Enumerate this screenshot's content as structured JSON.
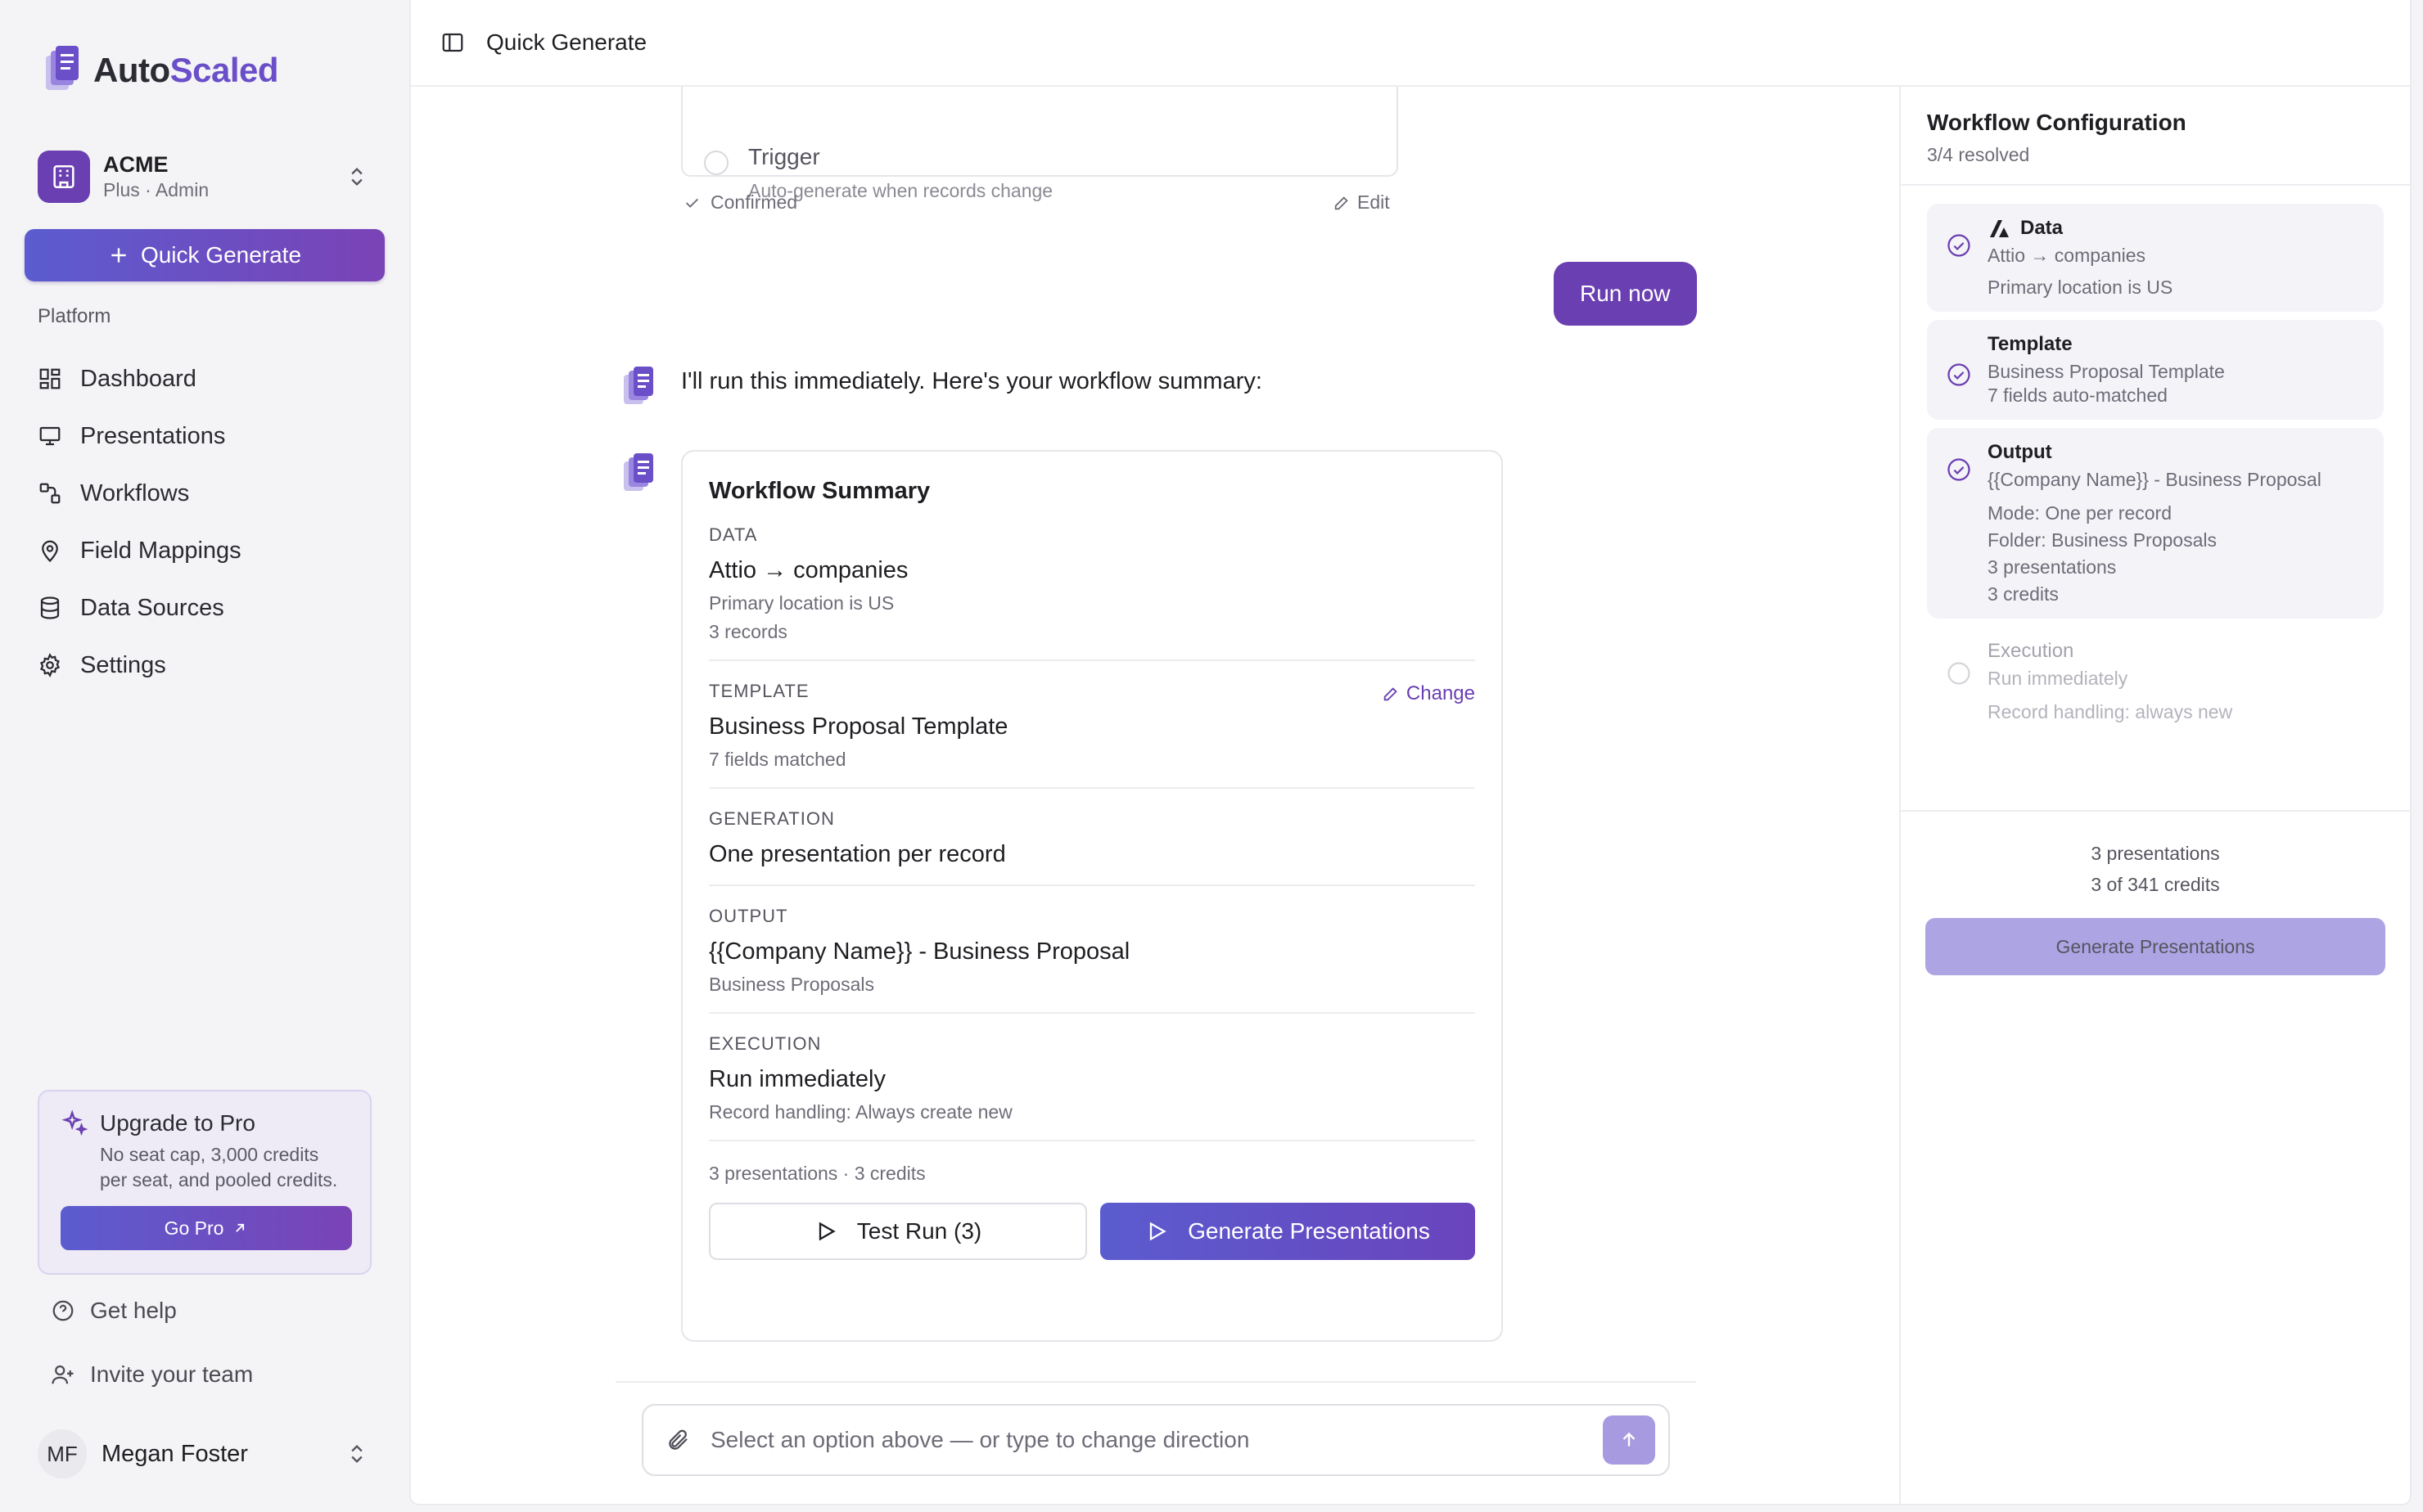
{
  "brand": {
    "name_part1": "Auto",
    "name_part2": "Scaled"
  },
  "org": {
    "name": "ACME",
    "plan": "Plus · Admin"
  },
  "sidebar": {
    "quick_generate": "Quick Generate",
    "section_label": "Platform",
    "items": [
      {
        "label": "Dashboard",
        "icon": "dashboard-icon"
      },
      {
        "label": "Presentations",
        "icon": "presentation-icon"
      },
      {
        "label": "Workflows",
        "icon": "workflow-icon"
      },
      {
        "label": "Field Mappings",
        "icon": "map-pin-icon"
      },
      {
        "label": "Data Sources",
        "icon": "database-icon"
      },
      {
        "label": "Settings",
        "icon": "gear-icon"
      }
    ],
    "upgrade": {
      "title": "Upgrade to Pro",
      "description": "No seat cap, 3,000 credits per seat, and pooled credits.",
      "cta": "Go Pro"
    },
    "help": "Get help",
    "invite": "Invite your team",
    "user": {
      "initials": "MF",
      "name": "Megan Foster"
    }
  },
  "topbar": {
    "title": "Quick Generate"
  },
  "chat": {
    "trigger": {
      "title": "Trigger",
      "subtitle": "Auto-generate when records change"
    },
    "confirmed": "Confirmed",
    "edit": "Edit",
    "user_message": "Run now",
    "bot_message": "I'll run this immediately. Here's your workflow summary:",
    "summary": {
      "title": "Workflow Summary",
      "data": {
        "label": "DATA",
        "main": "Attio → companies",
        "sub1": "Primary location is US",
        "sub2": "3 records"
      },
      "template": {
        "label": "TEMPLATE",
        "main": "Business Proposal Template",
        "sub": "7 fields matched",
        "change": "Change"
      },
      "generation": {
        "label": "GENERATION",
        "main": "One presentation per record"
      },
      "output": {
        "label": "OUTPUT",
        "main": "{{Company Name}} - Business Proposal",
        "sub": "Business Proposals"
      },
      "execution": {
        "label": "EXECUTION",
        "main": "Run immediately",
        "sub": "Record handling: Always create new"
      },
      "meta": "3 presentations · 3 credits",
      "test_run": "Test Run (3)",
      "generate": "Generate Presentations"
    },
    "composer_placeholder": "Select an option above — or type to change direction"
  },
  "config": {
    "title": "Workflow Configuration",
    "resolved": "3/4 resolved",
    "steps": {
      "data": {
        "title": "Data",
        "l1": "Attio → companies",
        "l2": "Primary location is US"
      },
      "template": {
        "title": "Template",
        "l1": "Business Proposal Template",
        "l2": "7 fields auto-matched"
      },
      "output": {
        "title": "Output",
        "l1": "{{Company Name}} - Business Proposal",
        "l2": "Mode: One per record",
        "l3": "Folder: Business Proposals",
        "l4": "3 presentations",
        "l5": "3 credits"
      },
      "execution": {
        "title": "Execution",
        "l1": "Run immediately",
        "l2": "Record handling: always new"
      }
    },
    "footer": {
      "presentations": "3 presentations",
      "credits": "3 of 341 credits",
      "generate": "Generate Presentations"
    }
  },
  "colors": {
    "accent": "#6a3fb1",
    "accent_gradient_start": "#5b5ccf",
    "disabled_button": "#ada4e4"
  }
}
